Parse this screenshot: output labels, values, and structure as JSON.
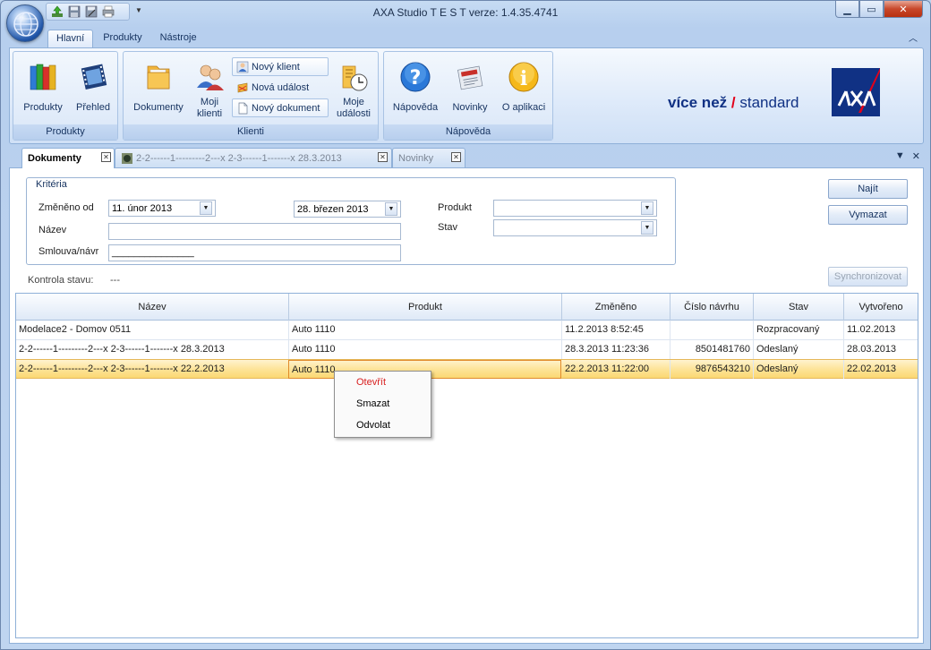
{
  "window": {
    "title": "AXA Studio  T E S T   verze: 1.4.35.4741",
    "buttons": {
      "minimize": "▁",
      "maximize": "▭",
      "close": "✕"
    }
  },
  "ribbon": {
    "tabs": [
      "Hlavní",
      "Produkty",
      "Nástroje"
    ],
    "groups": {
      "produkty": {
        "label": "Produkty",
        "buttons": [
          "Produkty",
          "Přehled"
        ]
      },
      "klienti": {
        "label": "Klienti",
        "big_buttons": [
          "Dokumenty",
          "Moji klienti",
          "Moje události"
        ],
        "small_buttons": [
          "Nový klient",
          "Nová událost",
          "Nový dokument"
        ]
      },
      "napoveda": {
        "label": "Nápověda",
        "buttons": [
          "Nápověda",
          "Novinky",
          "O aplikaci"
        ]
      }
    },
    "slogan": {
      "part1": "více než",
      "part2": "standard"
    }
  },
  "doc_tabs": [
    {
      "label": "Dokumenty",
      "active": true
    },
    {
      "label": "2-2------1---------2---x  2-3------1-------x  28.3.2013",
      "active": false
    },
    {
      "label": "Novinky",
      "active": false
    }
  ],
  "criteria": {
    "legend": "Kritéria",
    "changed_from_label": "Změněno od",
    "changed_from": "11. únor 2013",
    "changed_to": "28. březen 2013",
    "name_label": "Název",
    "name_value": "",
    "contract_label": "Smlouva/návr",
    "contract_value": "_______________",
    "product_label": "Produkt",
    "product_value": "",
    "state_label": "Stav",
    "state_value": ""
  },
  "actions": {
    "find": "Najít",
    "clear": "Vymazat",
    "sync": "Synchronizovat"
  },
  "status": {
    "label": "Kontrola stavu:",
    "value": "---"
  },
  "grid": {
    "columns": [
      "Název",
      "Produkt",
      "Změněno",
      "Číslo návrhu",
      "Stav",
      "Vytvořeno"
    ],
    "rows": [
      {
        "name": "Modelace2 - Domov 0511",
        "product": "Auto 1110",
        "changed": "11.2.2013 8:52:45",
        "number": "",
        "state": "Rozpracovaný",
        "created": "11.02.2013"
      },
      {
        "name": "2-2------1---------2---x  2-3------1-------x  28.3.2013",
        "product": "Auto 1110",
        "changed": "28.3.2013 11:23:36",
        "number": "8501481760",
        "state": "Odeslaný",
        "created": "28.03.2013"
      },
      {
        "name": "2-2------1---------2---x  2-3------1-------x  22.2.2013",
        "product": "Auto 1110",
        "changed": "22.2.2013 11:22:00",
        "number": "9876543210",
        "state": "Odeslaný",
        "created": "22.02.2013"
      }
    ],
    "selected_row": 2
  },
  "context_menu": {
    "items": [
      "Otevřít",
      "Smazat",
      "Odvolat"
    ]
  },
  "colors": {
    "accent_blue": "#103184",
    "axa_red": "#e2001a",
    "selection": "#fbd873",
    "menu_highlight": "#d81e1e"
  }
}
